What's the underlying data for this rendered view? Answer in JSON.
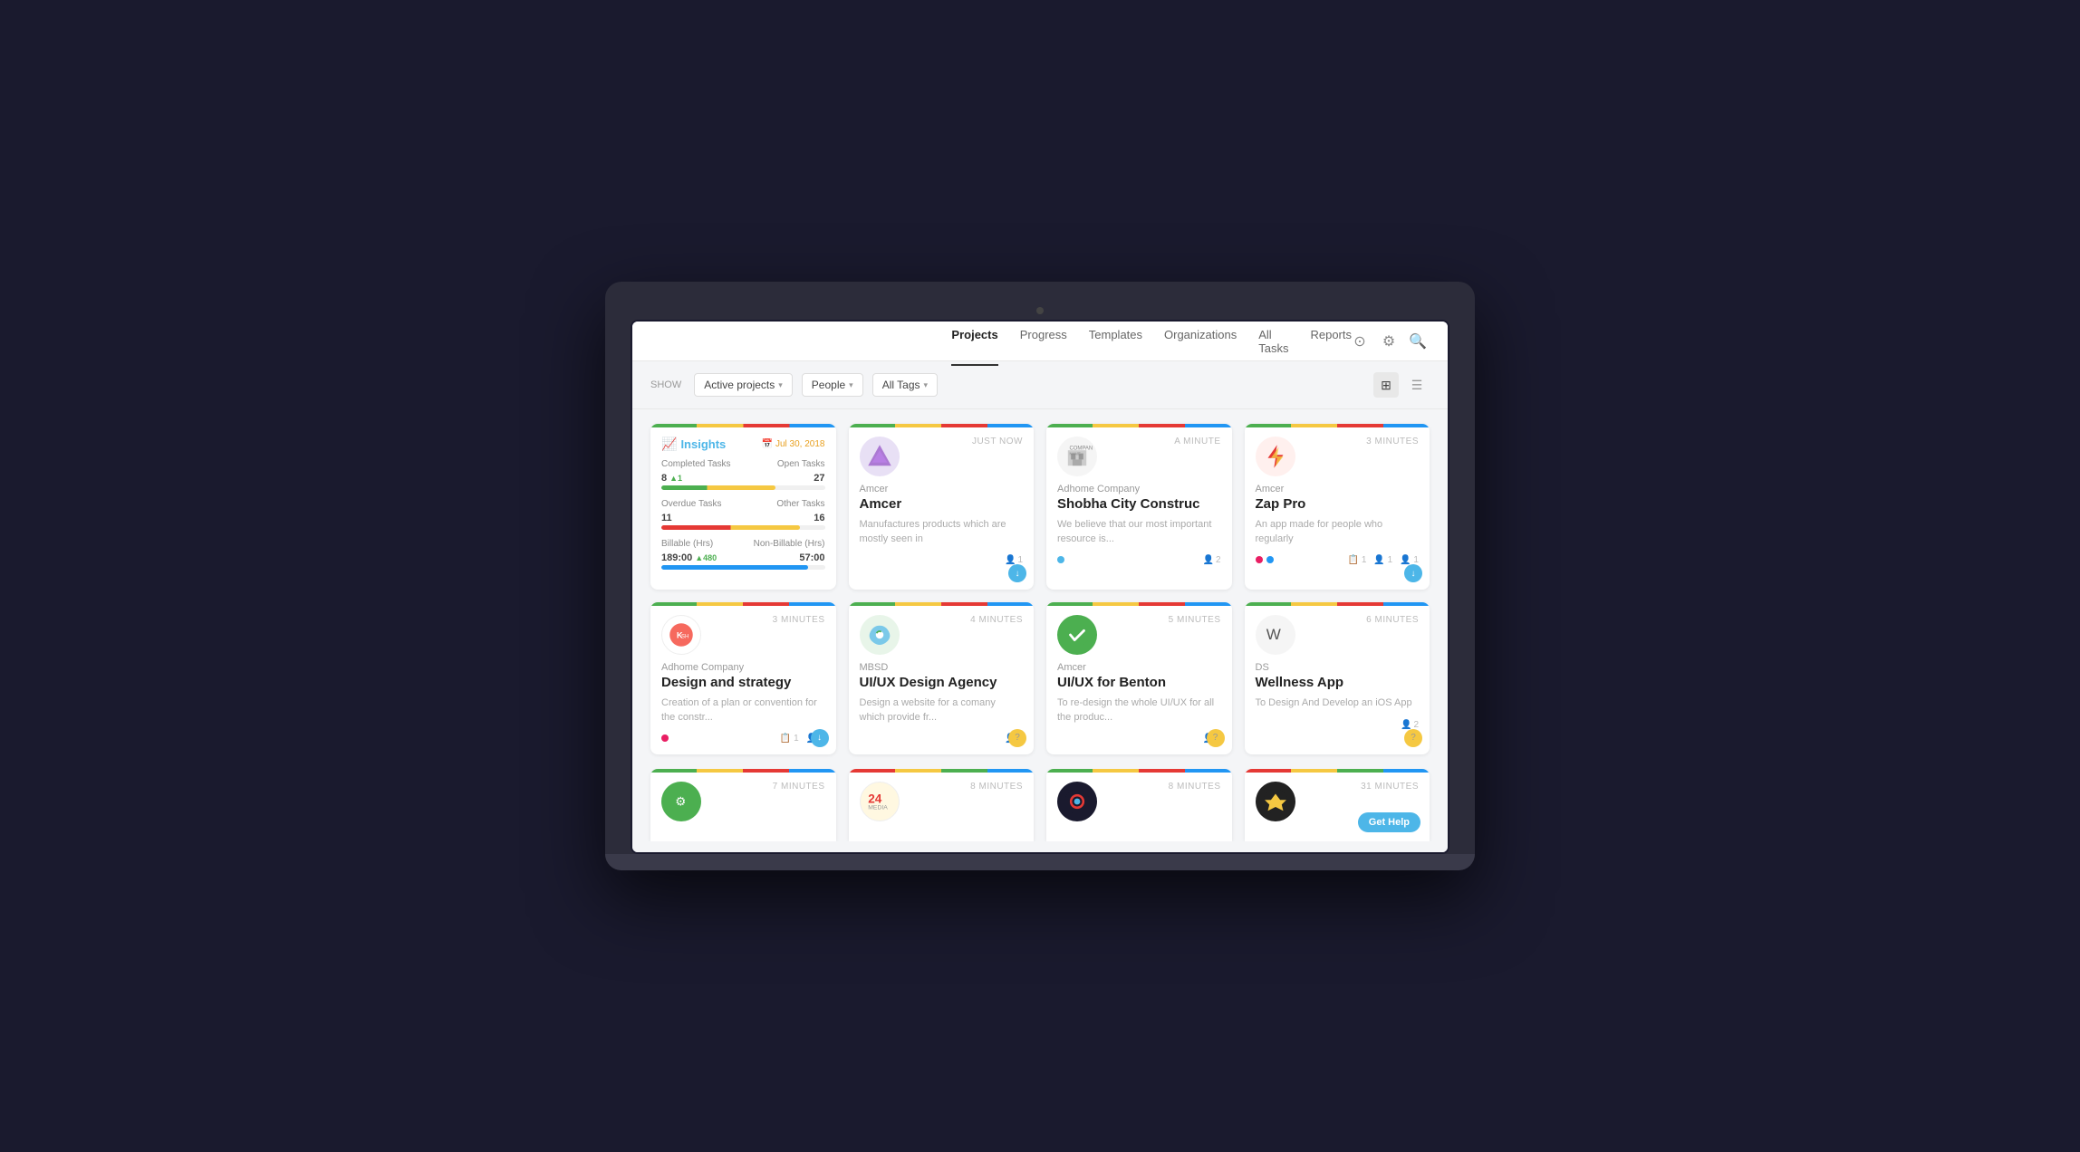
{
  "nav": {
    "links": [
      "Projects",
      "Progress",
      "Templates",
      "Organizations",
      "All Tasks",
      "Reports"
    ],
    "active": "Projects",
    "icons": [
      "target-icon",
      "gear-icon",
      "search-icon"
    ]
  },
  "filters": {
    "show_label": "SHOW",
    "active_projects": "Active projects",
    "people": "People",
    "all_tags": "All Tags",
    "dropdown_char": "▾"
  },
  "insights": {
    "title": "Insights",
    "date": "Jul 30, 2018",
    "completed_label": "Completed Tasks",
    "open_label": "Open Tasks",
    "completed_value": "8",
    "completed_up": "▲1",
    "open_value": "27",
    "overdue_label": "Overdue Tasks",
    "other_label": "Other Tasks",
    "overdue_value": "11",
    "other_value": "16",
    "billable_label": "Billable (Hrs)",
    "nonbillable_label": "Non-Billable (Hrs)",
    "billable_value": "189:00",
    "billable_up": "▲480",
    "nonbillable_value": "57:00"
  },
  "projects": [
    {
      "time": "JUST NOW",
      "org": "Amcer",
      "title": "Amcer",
      "desc": "Manufactures products which are mostly seen in",
      "logo_color": "#e8e0f5",
      "logo_char": "🦄",
      "bar": [
        "#4caf50",
        "#f5c842",
        "#e53935",
        "#2196f3"
      ],
      "dots": [],
      "members": "1",
      "badge": "blue",
      "badge_icon": "↓"
    },
    {
      "time": "A MINUTE",
      "org": "Adhome Company",
      "title": "Shobha City Construc",
      "desc": "We believe that our most important resource is...",
      "logo_color": "#f5f5f5",
      "logo_char": "🏢",
      "bar": [
        "#4caf50",
        "#f5c842",
        "#e53935",
        "#2196f3"
      ],
      "dots": [
        "#4db6e8"
      ],
      "members": "2",
      "badge": "",
      "badge_icon": ""
    },
    {
      "time": "3 MINUTES",
      "org": "Amcer",
      "title": "Zap Pro",
      "desc": "An app made for people who regularly",
      "logo_color": "#fff0ee",
      "logo_char": "⚡",
      "bar": [
        "#4caf50",
        "#f5c842",
        "#e53935",
        "#2196f3"
      ],
      "dots": [
        "#e91e63",
        "#2196f3"
      ],
      "members": "1",
      "tasks": "1",
      "members2": "1",
      "badge": "blue",
      "badge_icon": "↓"
    },
    {
      "time": "3 MINUTES",
      "org": "Adhome Company",
      "title": "Design and strategy",
      "desc": "Creation of a plan or convention for the constr...",
      "logo_color": "#fff",
      "logo_char": "🦀",
      "bar": [
        "#4caf50",
        "#f5c842",
        "#e53935",
        "#2196f3"
      ],
      "dots": [
        "#e91e63"
      ],
      "members": "2",
      "tasks": "1",
      "badge": "blue",
      "badge_icon": "↓"
    },
    {
      "time": "4 MINUTES",
      "org": "MBSD",
      "title": "UI/UX Design Agency",
      "desc": "Design a website for a comany which provide fr...",
      "logo_color": "#e8f5e9",
      "logo_char": "💎",
      "bar": [
        "#4caf50",
        "#f5c842",
        "#e53935",
        "#2196f3"
      ],
      "dots": [],
      "members": "1",
      "badge": "yellow",
      "badge_icon": "?"
    },
    {
      "time": "5 MINUTES",
      "org": "Amcer",
      "title": "UI/UX for Benton",
      "desc": "To re-design the whole UI/UX for all the produc...",
      "logo_color": "#4caf50",
      "logo_char": "✓",
      "bar": [
        "#4caf50",
        "#f5c842",
        "#e53935",
        "#2196f3"
      ],
      "dots": [],
      "members": "1",
      "badge": "yellow",
      "badge_icon": "?"
    },
    {
      "time": "6 MINUTES",
      "org": "DS",
      "title": "Wellness App",
      "desc": "To Design And Develop an iOS App",
      "logo_color": "#f5f5f5",
      "logo_char": "W",
      "bar": [
        "#4caf50",
        "#f5c842",
        "#e53935",
        "#2196f3"
      ],
      "dots": [],
      "members": "2",
      "badge": "yellow",
      "badge_icon": "?"
    }
  ],
  "partial_projects": [
    {
      "time": "7 MINUTES",
      "logo_color": "#4caf50",
      "logo_char": "⚙",
      "bar": [
        "#4caf50",
        "#f5c842",
        "#e53935",
        "#2196f3"
      ]
    },
    {
      "time": "8 MINUTES",
      "logo_color": "#fff",
      "logo_char": "24",
      "bar": [
        "#e53935",
        "#f5c842",
        "#4caf50",
        "#2196f3"
      ]
    },
    {
      "time": "8 MINUTES",
      "logo_color": "#1a1a2e",
      "logo_char": "◎",
      "bar": [
        "#4caf50",
        "#f5c842",
        "#e53935",
        "#2196f3"
      ]
    },
    {
      "time": "31 MINUTES",
      "logo_color": "#222",
      "logo_char": "⬡",
      "bar": [
        "#e53935",
        "#f5c842",
        "#4caf50",
        "#2196f3"
      ],
      "get_help": "Get Help"
    }
  ]
}
